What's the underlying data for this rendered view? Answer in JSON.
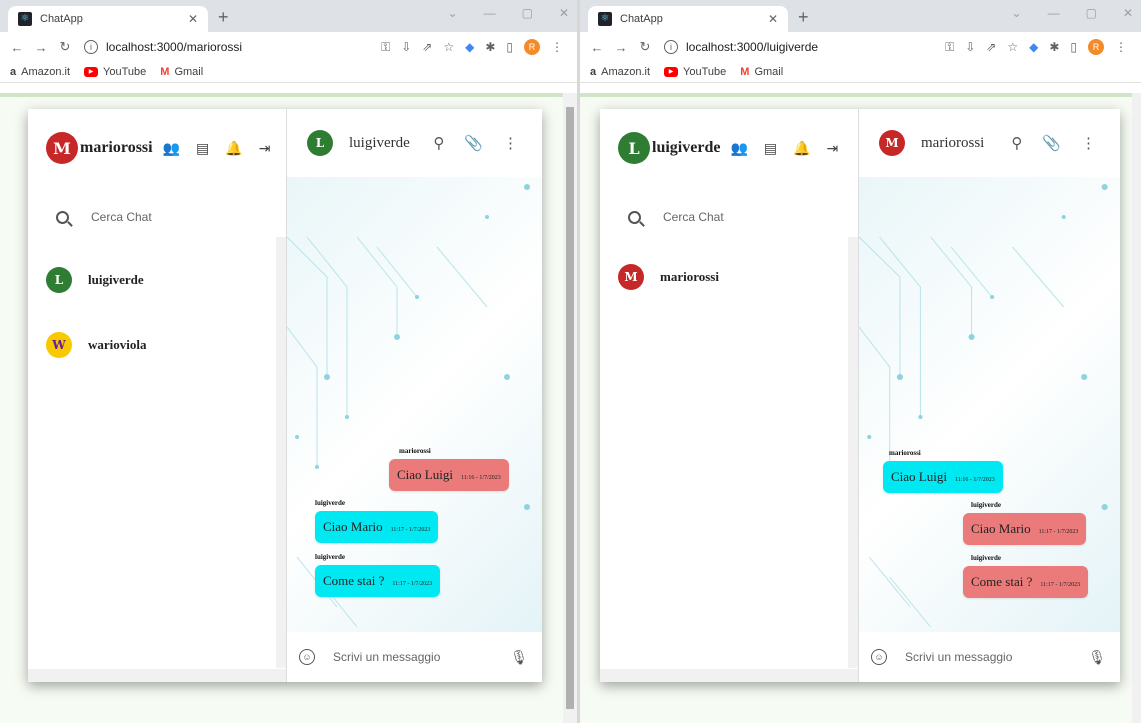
{
  "colors": {
    "sent_bubble": "#eb7b7b",
    "received_bubble": "#00e9f2"
  },
  "windows": [
    {
      "tab_title": "ChatApp",
      "url": "localhost:3000/mariorossi",
      "bookmarks": [
        "Amazon.it",
        "YouTube",
        "Gmail"
      ],
      "profile_initial": "R",
      "user": {
        "name": "mariorossi",
        "avatar": "mario"
      },
      "search_placeholder": "Cerca Chat",
      "contacts": [
        {
          "name": "luigiverde",
          "avatar": "luigi"
        },
        {
          "name": "warioviola",
          "avatar": "wario"
        }
      ],
      "chat": {
        "contact": "luigiverde",
        "contact_avatar": "luigi",
        "messages": [
          {
            "sender": "mariorossi",
            "text": "Ciao Luigi",
            "time": "11:16 - 1/7/2023",
            "own": true
          },
          {
            "sender": "luigiverde",
            "text": "Ciao Mario",
            "time": "11:17 - 1/7/2023",
            "own": false
          },
          {
            "sender": "luigiverde",
            "text": "Come stai ?",
            "time": "11:17 - 1/7/2023",
            "own": false
          }
        ],
        "composer_placeholder": "Scrivi un messaggio"
      }
    },
    {
      "tab_title": "ChatApp",
      "url": "localhost:3000/luigiverde",
      "bookmarks": [
        "Amazon.it",
        "YouTube",
        "Gmail"
      ],
      "profile_initial": "R",
      "user": {
        "name": "luigiverde",
        "avatar": "luigi"
      },
      "search_placeholder": "Cerca Chat",
      "contacts": [
        {
          "name": "mariorossi",
          "avatar": "mario"
        }
      ],
      "chat": {
        "contact": "mariorossi",
        "contact_avatar": "mario",
        "messages": [
          {
            "sender": "mariorossi",
            "text": "Ciao Luigi",
            "time": "11:16 - 1/7/2023",
            "own": false
          },
          {
            "sender": "luigiverde",
            "text": "Ciao Mario",
            "time": "11:17 - 1/7/2023",
            "own": true
          },
          {
            "sender": "luigiverde",
            "text": "Come stai ?",
            "time": "11:17 - 1/7/2023",
            "own": true
          }
        ],
        "composer_placeholder": "Scrivi un messaggio"
      }
    }
  ]
}
